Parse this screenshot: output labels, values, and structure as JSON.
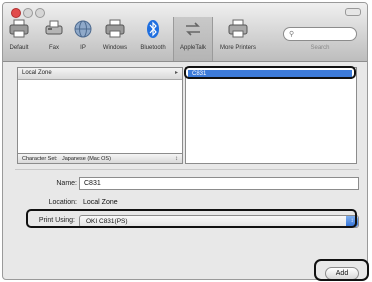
{
  "toolbar": {
    "items": [
      {
        "label": "Default",
        "icon": "printer-icon"
      },
      {
        "label": "Fax",
        "icon": "fax-icon"
      },
      {
        "label": "IP",
        "icon": "globe-icon"
      },
      {
        "label": "Windows",
        "icon": "windows-printer-icon"
      },
      {
        "label": "Bluetooth",
        "icon": "bluetooth-icon"
      },
      {
        "label": "AppleTalk",
        "icon": "appletalk-icon"
      },
      {
        "label": "More Printers",
        "icon": "more-printers-icon"
      }
    ],
    "search_label": "Search"
  },
  "browser": {
    "zone_header": "Local Zone",
    "selected_printer": "C831",
    "charset_label": "Character Set:",
    "charset_value": "Japanese (Mac OS)"
  },
  "form": {
    "name_label": "Name:",
    "name_value": "C831",
    "location_label": "Location:",
    "location_value": "Local Zone",
    "print_using_label": "Print Using:",
    "print_using_value": "OKI C831(PS)"
  },
  "actions": {
    "add_label": "Add"
  },
  "colors": {
    "selection": "#3d7bd9",
    "bluetooth": "#1f6fe0"
  }
}
